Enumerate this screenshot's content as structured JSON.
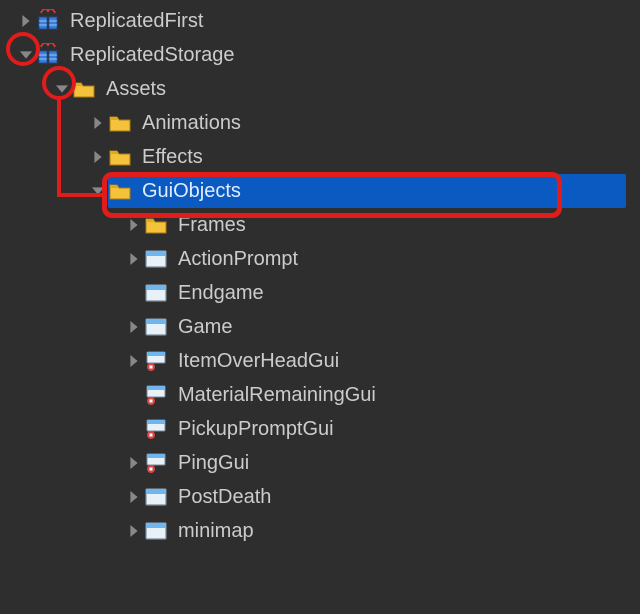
{
  "tree": {
    "items": [
      {
        "depth": 0,
        "arrow": "right",
        "icon": "replicated",
        "label": "ReplicatedFirst",
        "selected": false
      },
      {
        "depth": 0,
        "arrow": "down",
        "icon": "replicated",
        "label": "ReplicatedStorage",
        "selected": false
      },
      {
        "depth": 1,
        "arrow": "down",
        "icon": "folder",
        "label": "Assets",
        "selected": false
      },
      {
        "depth": 2,
        "arrow": "right",
        "icon": "folder",
        "label": "Animations",
        "selected": false
      },
      {
        "depth": 2,
        "arrow": "right",
        "icon": "folder",
        "label": "Effects",
        "selected": false
      },
      {
        "depth": 2,
        "arrow": "down",
        "icon": "folder",
        "label": "GuiObjects",
        "selected": true
      },
      {
        "depth": 3,
        "arrow": "right",
        "icon": "folder",
        "label": "Frames",
        "selected": false
      },
      {
        "depth": 3,
        "arrow": "right",
        "icon": "screengui",
        "label": "ActionPrompt",
        "selected": false
      },
      {
        "depth": 3,
        "arrow": "none",
        "icon": "screengui",
        "label": "Endgame",
        "selected": false
      },
      {
        "depth": 3,
        "arrow": "right",
        "icon": "screengui",
        "label": "Game",
        "selected": false
      },
      {
        "depth": 3,
        "arrow": "right",
        "icon": "billboard",
        "label": "ItemOverHeadGui",
        "selected": false
      },
      {
        "depth": 3,
        "arrow": "none",
        "icon": "billboard",
        "label": "MaterialRemainingGui",
        "selected": false
      },
      {
        "depth": 3,
        "arrow": "none",
        "icon": "billboard",
        "label": "PickupPromptGui",
        "selected": false
      },
      {
        "depth": 3,
        "arrow": "right",
        "icon": "billboard",
        "label": "PingGui",
        "selected": false
      },
      {
        "depth": 3,
        "arrow": "right",
        "icon": "screengui",
        "label": "PostDeath",
        "selected": false
      },
      {
        "depth": 3,
        "arrow": "right",
        "icon": "screengui",
        "label": "minimap",
        "selected": false
      }
    ]
  }
}
